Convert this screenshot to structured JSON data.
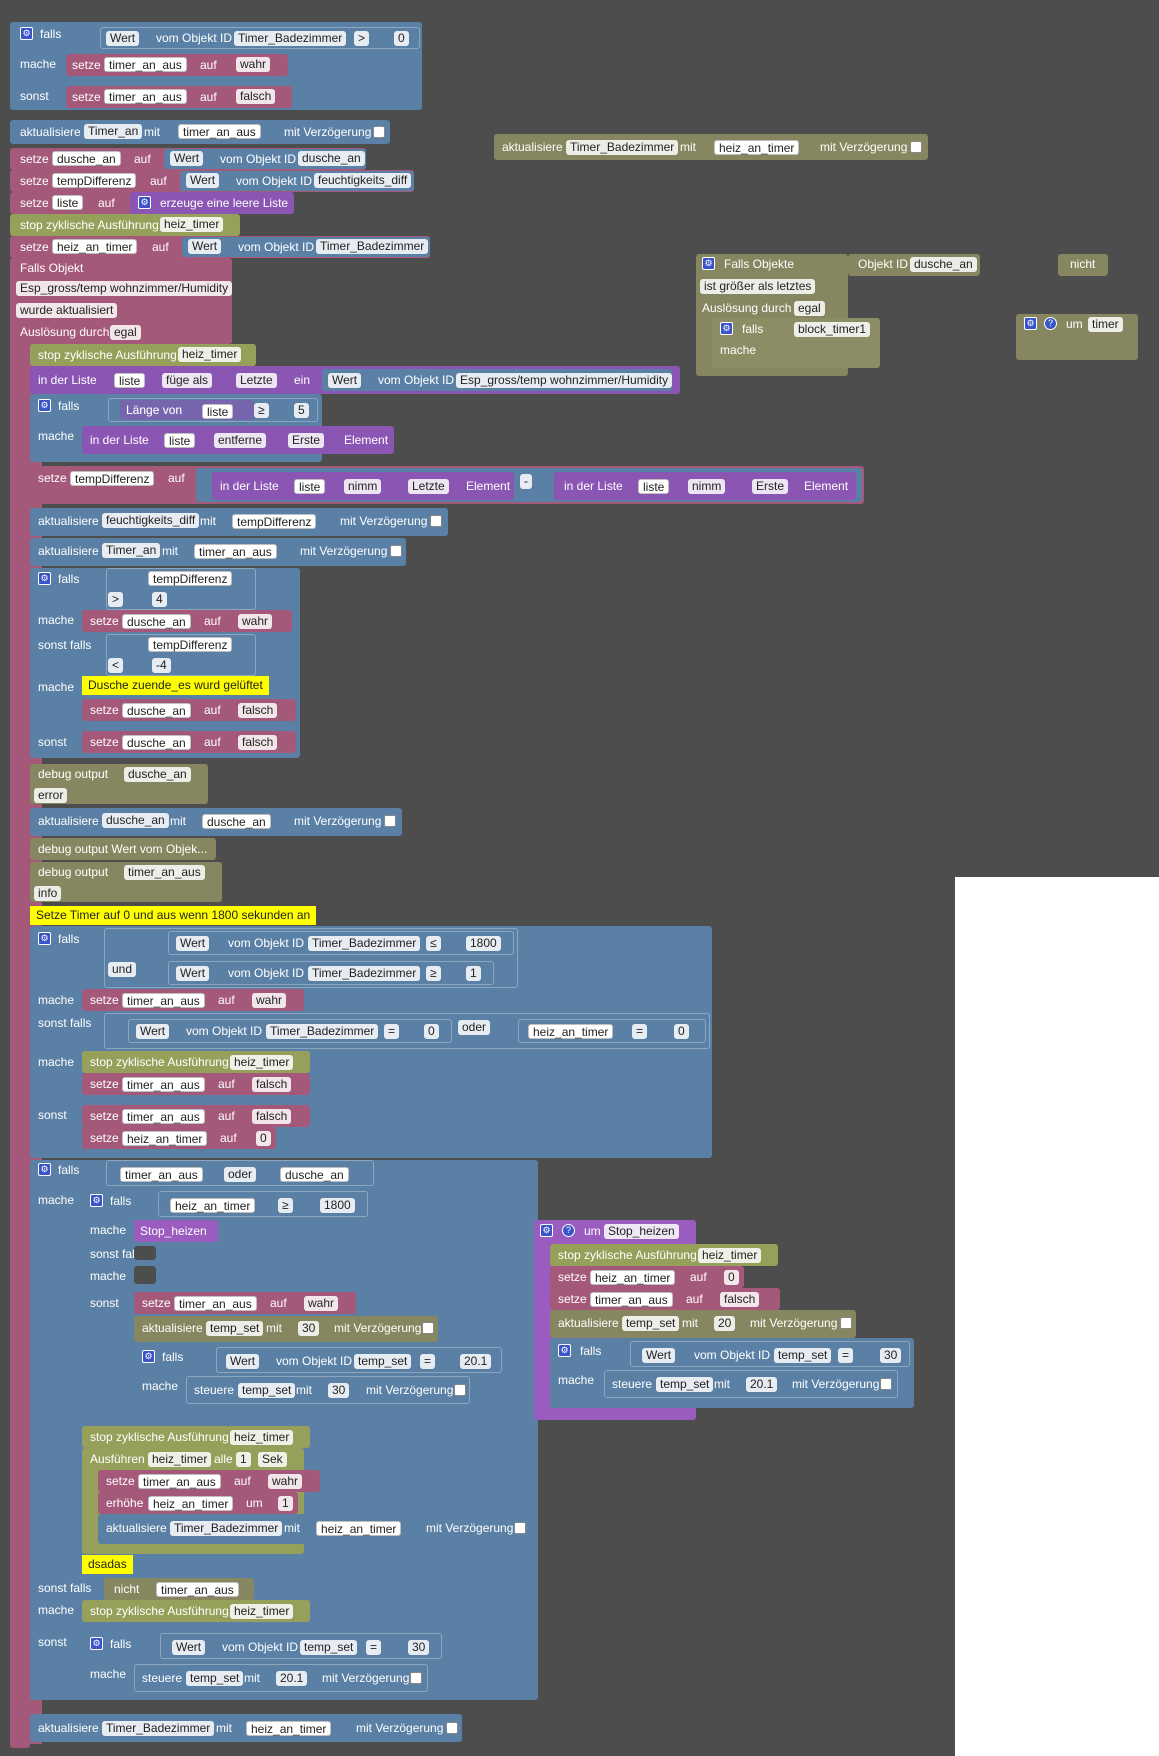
{
  "colors": {
    "workspace": "#4d4d4d",
    "logic": "#5b80a5",
    "variables": "#a5597a",
    "timers": "#97a05b",
    "debug": "#868660",
    "lists": "#8a55b3",
    "comment": "#ffff00"
  },
  "kw": {
    "falls": "falls",
    "mache": "mache",
    "sonst": "sonst",
    "sonst_falls": "sonst falls",
    "setze": "setze",
    "auf": "auf",
    "mit": "mit",
    "mit_verzoegerung": "mit Verzögerung",
    "aktualisiere": "aktualisiere",
    "steuere": "steuere",
    "vom_objekt_id": "vom Objekt ID",
    "wert": "Wert",
    "wahr": "wahr",
    "falsch": "falsch",
    "und": "und",
    "oder": "oder",
    "nicht": "nicht",
    "stop": "stop zyklische Ausführung",
    "in_der_liste": "in der Liste",
    "element": "Element",
    "um": "um",
    "debug_output": "debug output",
    "ein": "ein"
  },
  "vars": {
    "timer_an_aus": "timer_an_aus",
    "dusche_an": "dusche_an",
    "tempDifferenz": "tempDifferenz",
    "liste": "liste",
    "heiz_an_timer": "heiz_an_timer",
    "heiz_timer": "heiz_timer",
    "block_timer1": "block_timer1"
  },
  "objects": {
    "timer_badezimmer": "Timer_Badezimmer",
    "timer_an": "Timer_an",
    "dusche_an": "dusche_an",
    "feuchtigkeits_diff": "feuchtigkeits_diff",
    "esp": "Esp_gross/temp wohnzimmer/Humidity",
    "temp_set": "temp_set"
  },
  "ops": {
    "gt": ">",
    "ge": "≥",
    "le": "≤",
    "lt": "<",
    "eq": "=",
    "minus": "-"
  },
  "nums": {
    "n0": "0",
    "n1": "1",
    "n4": "4",
    "nm4": "-4",
    "n5": "5",
    "n20": "20",
    "n30": "30",
    "n201": "20.1",
    "n1800": "1800"
  },
  "labels": {
    "erzeuge_liste": "erzeuge eine leere Liste",
    "falls_objekt": "Falls Objekt",
    "wurde_aktualisiert": "wurde aktualisiert",
    "ausloesung_durch": "Auslösung durch",
    "egal": "egal",
    "fuege_als": "füge als",
    "letzte": "Letzte",
    "erste": "Erste",
    "entferne": "entferne",
    "nimm": "nimm",
    "laenge_von": "Länge von",
    "error": "error",
    "info": "info",
    "debug_wert": "debug output Wert vom Objek...",
    "ausfuehren": "Ausführen",
    "alle": "alle",
    "sek": "Sek",
    "erhoehe": "erhöhe",
    "stop_heizen": "Stop_heizen",
    "falls_objekte": "Falls Objekte",
    "objekt_id": "Objekt ID",
    "groesser": "ist größer als letztes",
    "timer_fn": "timer",
    "dsadas": "dsadas"
  },
  "comments": {
    "c1": "Dusche zuende_es wurd gelüftet",
    "c2": "Setze Timer auf 0 und aus wenn 1800 sekunden an"
  }
}
